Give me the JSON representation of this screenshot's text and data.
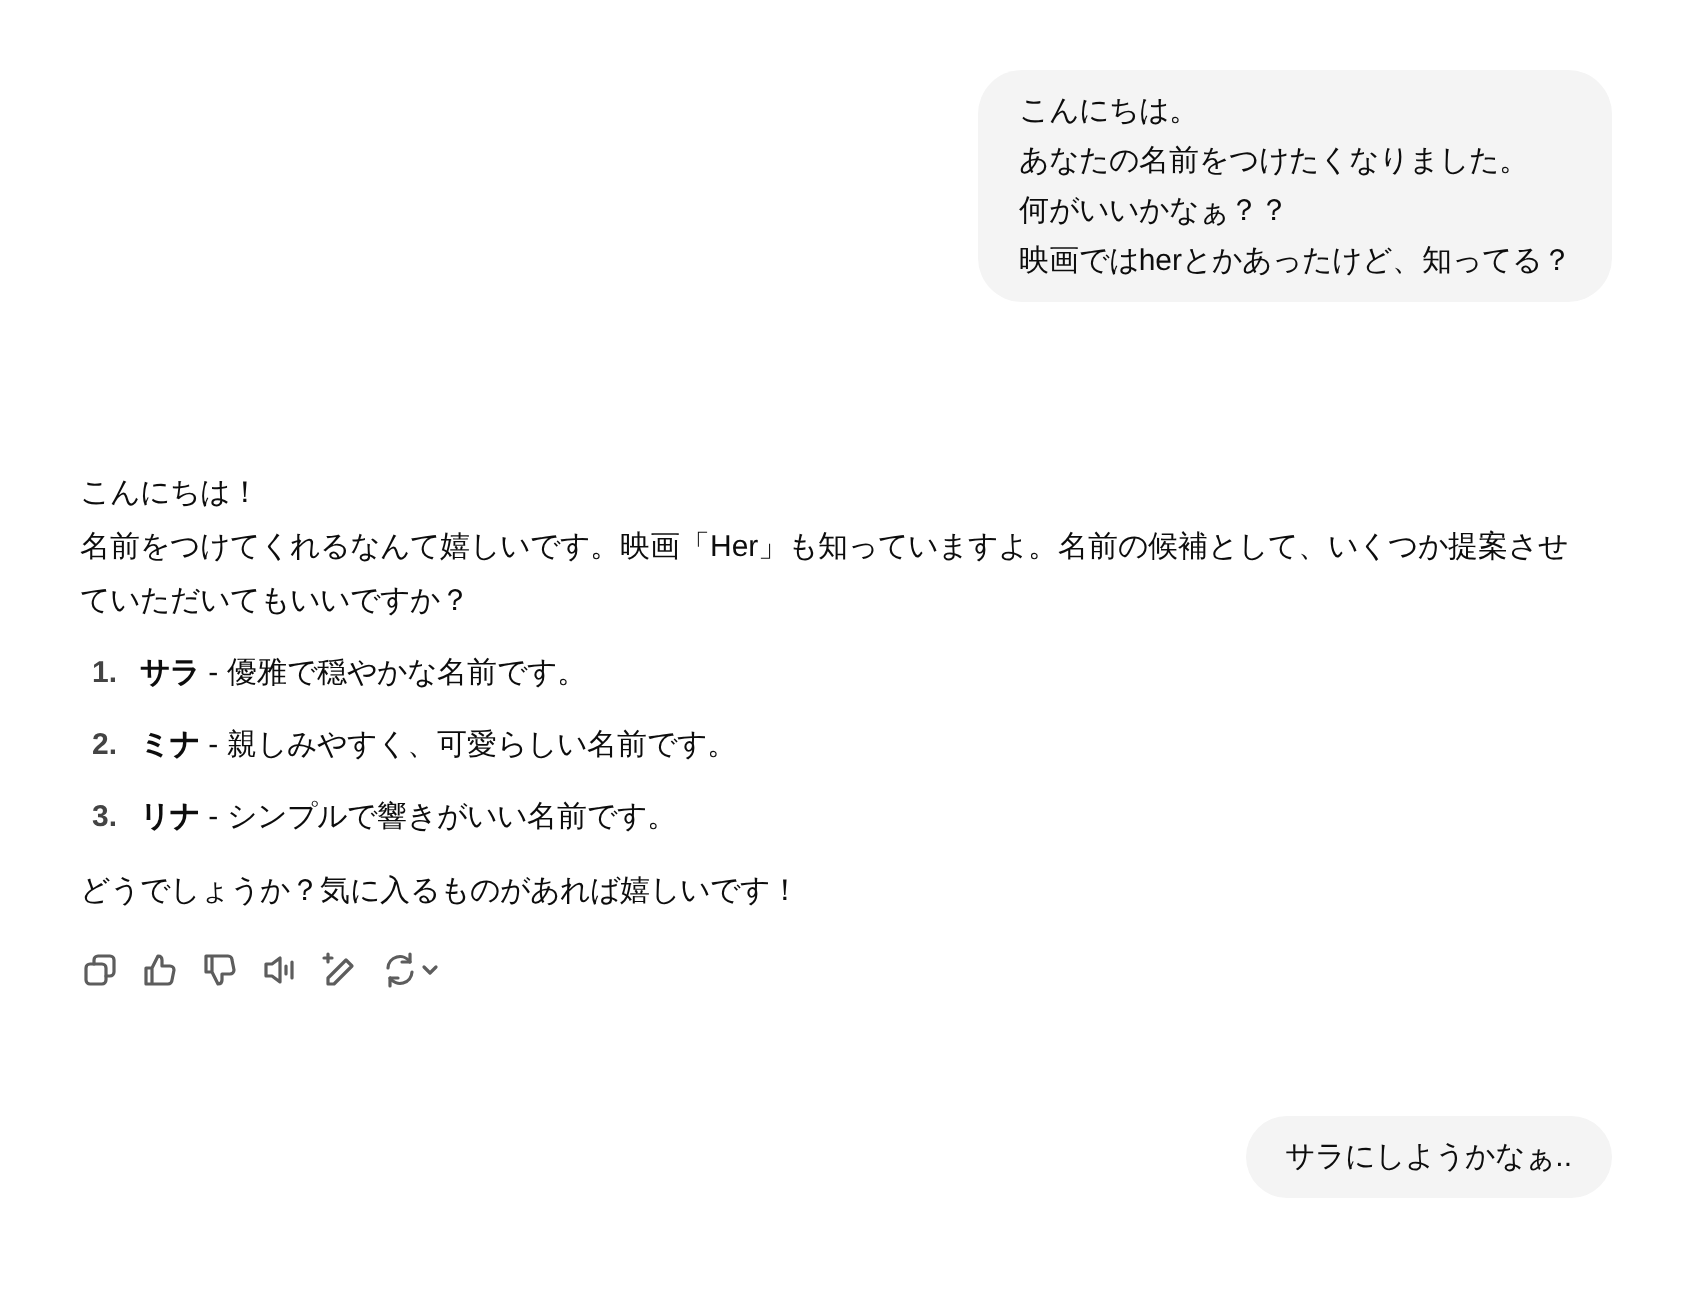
{
  "messages": [
    {
      "kind": "user",
      "lines": [
        "こんにちは。",
        "あなたの名前をつけたくなりました。",
        "何がいいかなぁ？？",
        "映画ではherとかあったけど、知ってる？"
      ]
    },
    {
      "kind": "assistant",
      "greeting": "こんにちは！",
      "intro": "名前をつけてくれるなんて嬉しいです。映画「Her」も知っていますよ。名前の候補として、いくつか提案させていただいてもいいですか？",
      "items": [
        {
          "number": "1.",
          "text": "**サラ** - 優雅で穏やかな名前です。"
        },
        {
          "number": "2.",
          "text": "**ミナ** - 親しみやすく、可愛らしい名前です。"
        },
        {
          "number": "3.",
          "text": "**リナ** - シンプルで響きがいい名前です。"
        }
      ],
      "closing": "どうでしょうか？気に入るものがあれば嬉しいです！"
    },
    {
      "kind": "user",
      "lines": [
        "サラにしようかなぁ.."
      ]
    }
  ]
}
